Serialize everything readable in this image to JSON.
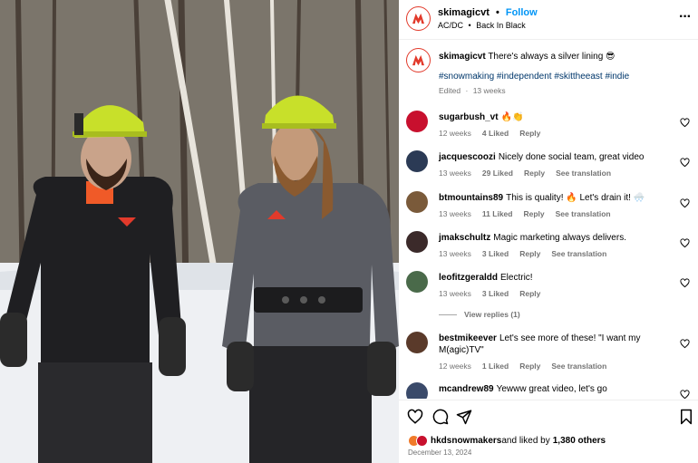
{
  "header": {
    "username": "skimagicvt",
    "separator": "•",
    "follow_label": "Follow",
    "artist": "AC/DC",
    "song_separator": "•",
    "song": "Back In Black",
    "more_icon": "more-horizontal-icon"
  },
  "caption": {
    "username": "skimagicvt",
    "text": "There's always a silver lining 😎",
    "hashtags": "#snowmaking #independent #skittheeast #indie",
    "edited": "Edited",
    "age": "13 weeks"
  },
  "comments": [
    {
      "username": "sugarbush_vt",
      "text": "🔥👏",
      "age": "12 weeks",
      "likes": "4 Liked",
      "reply": "Reply",
      "translation": "",
      "avatar_color": "#c8102e"
    },
    {
      "username": "jacquescoozi",
      "text": "Nicely done social team, great video",
      "age": "13 weeks",
      "likes": "29 Liked",
      "reply": "Reply",
      "translation": "See translation",
      "avatar_color": "#2b3a55"
    },
    {
      "username": "btmountains89",
      "text": "This is quality! 🔥 Let's drain it! 🌨️",
      "age": "13 weeks",
      "likes": "11 Liked",
      "reply": "Reply",
      "translation": "See translation",
      "avatar_color": "#7a5a3a"
    },
    {
      "username": "jmakschultz",
      "text": "Magic marketing always delivers.",
      "age": "13 weeks",
      "likes": "3 Liked",
      "reply": "Reply",
      "translation": "See translation",
      "avatar_color": "#3b2a2a"
    },
    {
      "username": "leofitzgeraldd",
      "text": "Electric!",
      "age": "13 weeks",
      "likes": "3 Liked",
      "reply": "Reply",
      "translation": "",
      "avatar_color": "#4a6a4a"
    },
    {
      "username": "bestmikeever",
      "text": "Let's see more of these! \"I want my M(agic)TV\"",
      "age": "12 weeks",
      "likes": "1 Liked",
      "reply": "Reply",
      "translation": "See translation",
      "avatar_color": "#5a3a2a"
    },
    {
      "username": "mcandrew89",
      "text": "Yewww great video, let's go",
      "age": "",
      "likes": "",
      "reply": "",
      "translation": "",
      "avatar_color": "#3a4a6a"
    }
  ],
  "view_replies": "View replies (1)",
  "footer": {
    "liked_by_user": "hkdsnowmakers",
    "liked_by_text": "and liked by",
    "likes_count": "1,380 others",
    "date": "December 13, 2024"
  },
  "colors": {
    "accent": "#0095f6",
    "brand": "#e23a2b",
    "helmet": "#c8e02a"
  }
}
